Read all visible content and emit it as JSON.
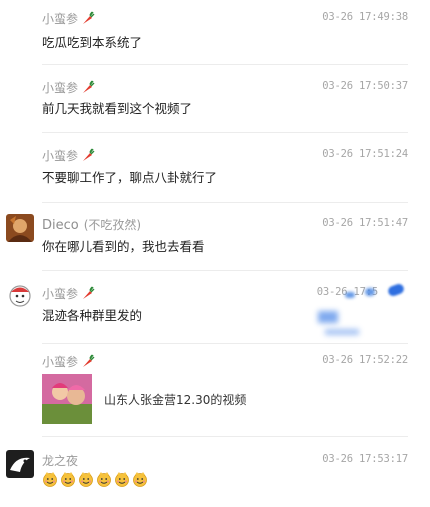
{
  "messages": [
    {
      "sender": "小蛮参",
      "time": "03-26 17:49:38",
      "text": "吃瓜吃到本系统了"
    },
    {
      "sender": "小蛮参",
      "time": "03-26 17:50:37",
      "text": "前几天我就看到这个视频了"
    },
    {
      "sender": "小蛮参",
      "time": "03-26 17:51:24",
      "text": "不要聊工作了，聊点八卦就行了"
    },
    {
      "sender": "Dieco",
      "sender_note": "(不吃孜然)",
      "time": "03-26 17:51:47",
      "text": "你在哪儿看到的，我也去看看"
    },
    {
      "sender": "小蛮参",
      "time": "03-26 17:5",
      "text": "混迹各种群里发的"
    },
    {
      "sender": "小蛮参",
      "time": "03-26 17:52:22",
      "card_title": "山东人张金营12.30的视频"
    },
    {
      "sender": "龙之夜",
      "time": "03-26 17:53:17",
      "emoji_count": 6
    }
  ],
  "colors": {
    "name": "#9a9a9a",
    "time": "#a6a6a6",
    "text": "#222222",
    "separator": "#ececec",
    "blur": "#3b7de0"
  },
  "icons": {
    "nick_badge": "carrot-icon",
    "emoji": "smiley-face-emoji"
  }
}
